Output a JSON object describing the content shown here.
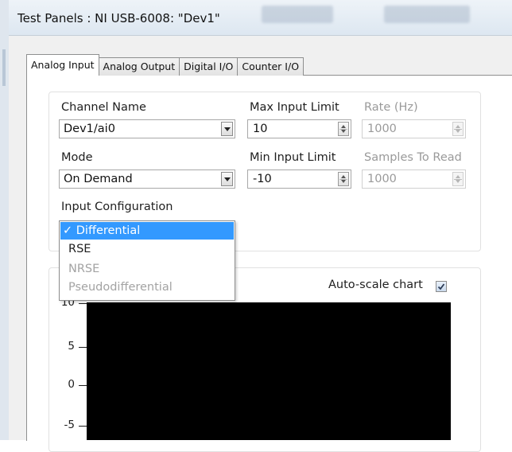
{
  "window": {
    "title": "Test Panels : NI USB-6008: \"Dev1\""
  },
  "tabs": [
    {
      "label": "Analog Input",
      "active": true
    },
    {
      "label": "Analog Output",
      "active": false
    },
    {
      "label": "Digital I/O",
      "active": false
    },
    {
      "label": "Counter I/O",
      "active": false
    }
  ],
  "config": {
    "channel_name": {
      "label": "Channel Name",
      "value": "Dev1/ai0"
    },
    "max_input_limit": {
      "label": "Max Input Limit",
      "value": "10"
    },
    "rate": {
      "label": "Rate (Hz)",
      "value": "1000"
    },
    "mode": {
      "label": "Mode",
      "value": "On Demand"
    },
    "min_input_limit": {
      "label": "Min Input Limit",
      "value": "-10"
    },
    "samples_to_read": {
      "label": "Samples To Read",
      "value": "1000"
    },
    "input_configuration": {
      "label": "Input Configuration",
      "options": [
        {
          "label": "✓ Differential",
          "selected": true,
          "enabled": true
        },
        {
          "label": "RSE",
          "selected": false,
          "enabled": true
        },
        {
          "label": "NRSE",
          "selected": false,
          "enabled": false
        },
        {
          "label": "Pseudodifferential",
          "selected": false,
          "enabled": false
        }
      ]
    }
  },
  "chart": {
    "autoscale_label": "Auto-scale chart",
    "autoscale_checked": true,
    "y_ticks": [
      "10",
      "5",
      "0",
      "-5"
    ],
    "background": "#000000"
  },
  "colors": {
    "selection": "#3399ff",
    "disabled_text": "#9a9a9a"
  }
}
